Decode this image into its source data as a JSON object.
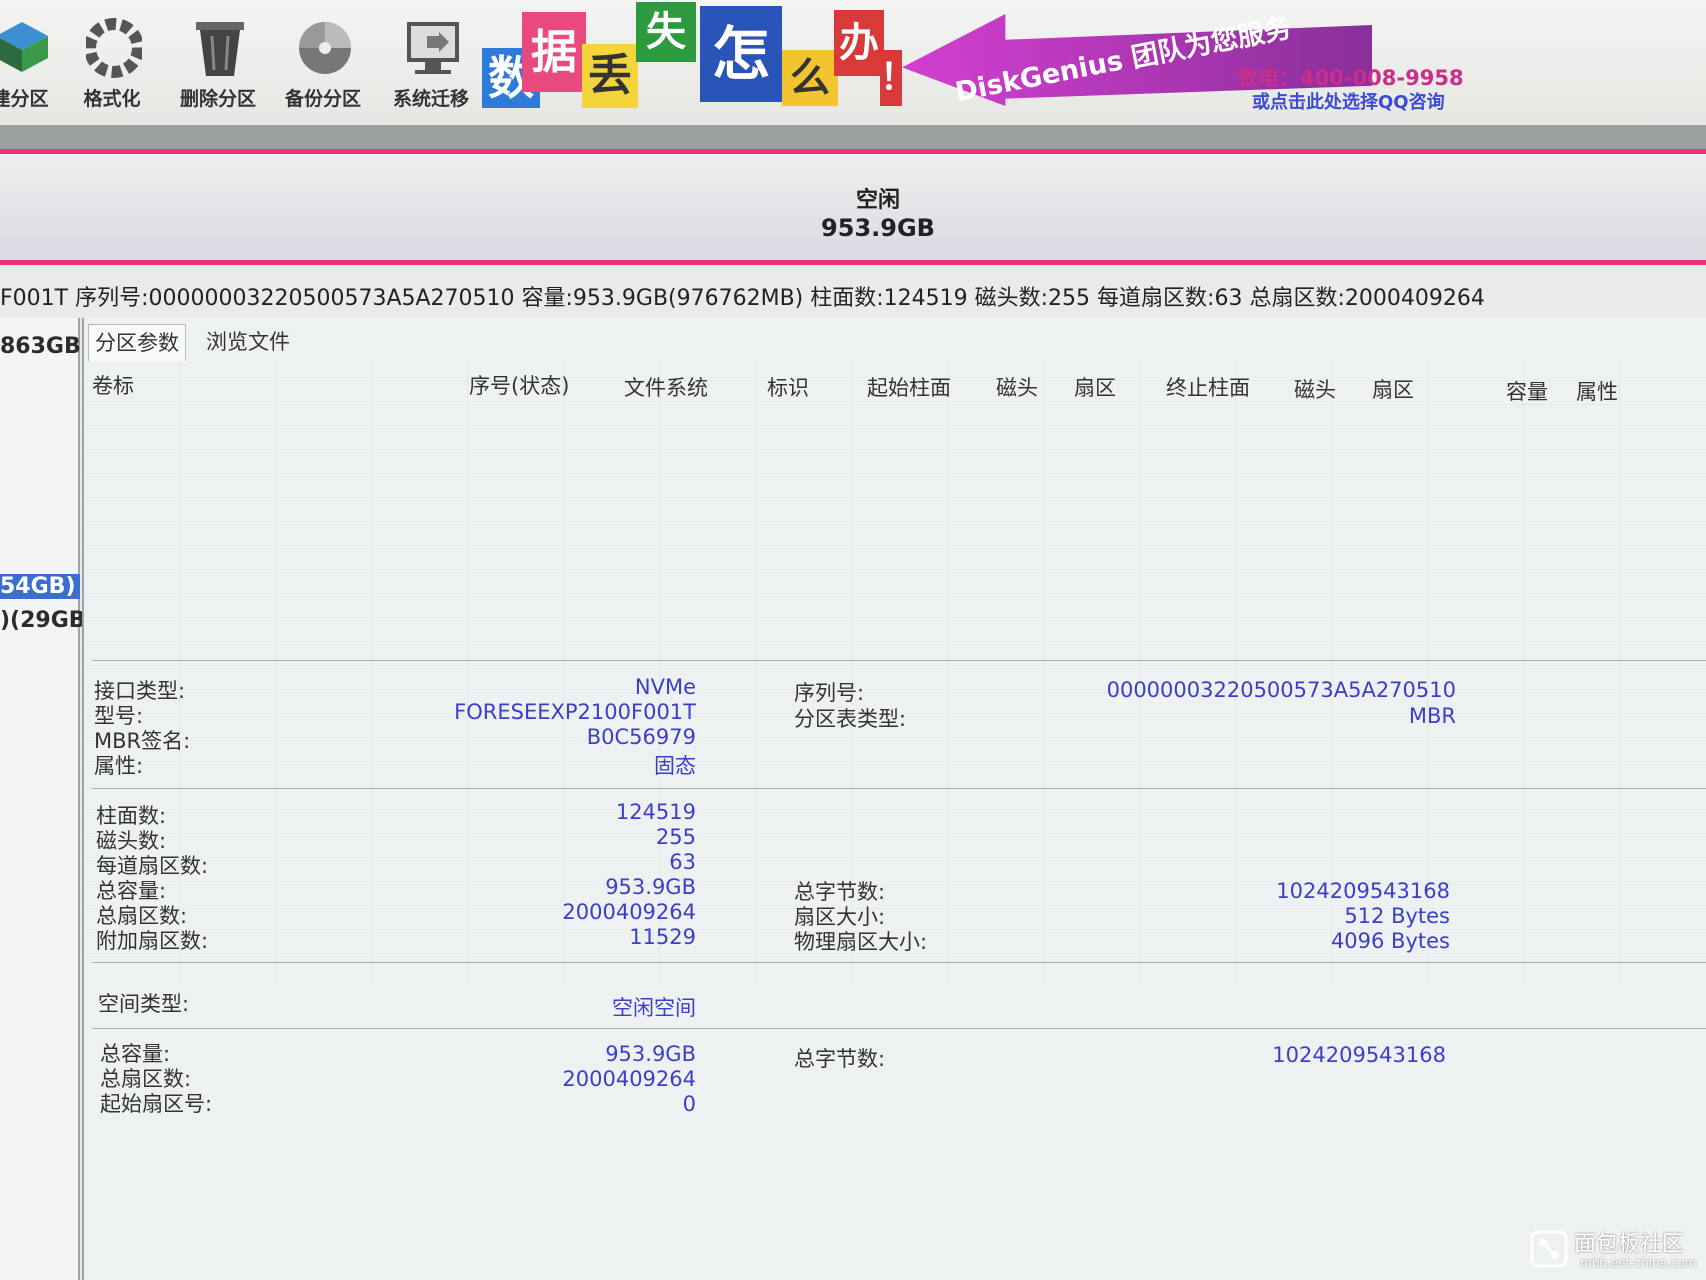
{
  "toolbar": {
    "buttons": [
      {
        "label": "建分区",
        "icon": "new-partition-icon"
      },
      {
        "label": "格式化",
        "icon": "format-icon"
      },
      {
        "label": "删除分区",
        "icon": "delete-partition-icon"
      },
      {
        "label": "备份分区",
        "icon": "backup-partition-icon"
      },
      {
        "label": "系统迁移",
        "icon": "system-migration-icon"
      }
    ]
  },
  "banner": {
    "tiles": [
      "数",
      "据",
      "丢",
      "失",
      "怎",
      "么",
      "办",
      "！"
    ],
    "slogan": "DiskGenius 团队为您服务",
    "hotline": "致电：400-008-9958",
    "qq": "或点击此处选择QQ咨询"
  },
  "disk_map": {
    "status": "空闲",
    "size": "953.9GB"
  },
  "info_line": "F001T  序列号:00000003220500573A5A270510  容量:953.9GB(976762MB)  柱面数:124519  磁头数:255  每道扇区数:63  总扇区数:2000409264",
  "left_panel": {
    "items": [
      "863GB",
      "54GB)",
      ")(29GB"
    ]
  },
  "tabs": [
    "分区参数",
    "浏览文件"
  ],
  "columns": [
    "卷标",
    "序号(状态)",
    "文件系统",
    "标识",
    "起始柱面",
    "磁头",
    "扇区",
    "终止柱面",
    "磁头",
    "扇区",
    "容量",
    "属性"
  ],
  "disk_info": {
    "interface": {
      "label": "接口类型:",
      "value": "NVMe"
    },
    "model": {
      "label": "型号:",
      "value": "FORESEEXP2100F001T"
    },
    "mbr_sig": {
      "label": "MBR签名:",
      "value": "B0C56979"
    },
    "attr": {
      "label": "属性:",
      "value": "固态"
    },
    "serial": {
      "label": "序列号:",
      "value": "00000003220500573A5A270510"
    },
    "pt_type": {
      "label": "分区表类型:",
      "value": "MBR"
    }
  },
  "geometry": {
    "cylinders": {
      "label": "柱面数:",
      "value": "124519"
    },
    "heads": {
      "label": "磁头数:",
      "value": "255"
    },
    "spt": {
      "label": "每道扇区数:",
      "value": "63"
    },
    "capacity": {
      "label": "总容量:",
      "value": "953.9GB"
    },
    "sectors": {
      "label": "总扇区数:",
      "value": "2000409264"
    },
    "extra": {
      "label": "附加扇区数:",
      "value": "11529"
    },
    "bytes": {
      "label": "总字节数:",
      "value": "1024209543168"
    },
    "sector_size": {
      "label": "扇区大小:",
      "value": "512 Bytes"
    },
    "phys_sector": {
      "label": "物理扇区大小:",
      "value": "4096 Bytes"
    }
  },
  "space": {
    "type": {
      "label": "空间类型:",
      "value": "空闲空间"
    },
    "capacity": {
      "label": "总容量:",
      "value": "953.9GB"
    },
    "sectors": {
      "label": "总扇区数:",
      "value": "2000409264"
    },
    "start": {
      "label": "起始扇区号:",
      "value": "0"
    },
    "bytes": {
      "label": "总字节数:",
      "value": "1024209543168"
    }
  },
  "watermark": {
    "main": "面包板社区",
    "sub": "mbb.eet-china.com"
  },
  "colors": {
    "accent_pink": "#e8357a",
    "value_blue": "#3b3fc8",
    "banner_purple": "#b13bb8"
  }
}
